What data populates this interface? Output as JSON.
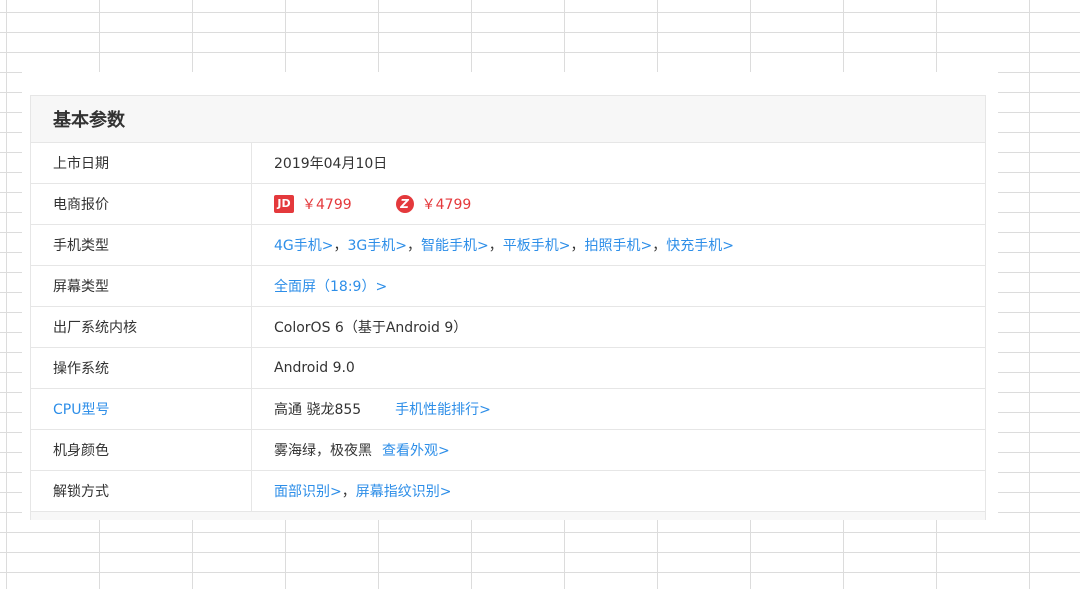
{
  "section": {
    "title": "基本参数"
  },
  "rows": {
    "release_date": {
      "label": "上市日期",
      "value": "2019年04月10日"
    },
    "price": {
      "label": "电商报价",
      "jd_badge": "JD",
      "jd_price": "￥4799",
      "z_badge": "Z",
      "z_price": "￥4799"
    },
    "phone_type": {
      "label": "手机类型",
      "links": [
        "4G手机>",
        "3G手机>",
        "智能手机>",
        "平板手机>",
        "拍照手机>",
        "快充手机>"
      ],
      "sep": "，"
    },
    "screen_type": {
      "label": "屏幕类型",
      "link": "全面屏（18:9）>"
    },
    "kernel": {
      "label": "出厂系统内核",
      "value": "ColorOS 6（基于Android 9）"
    },
    "os": {
      "label": "操作系统",
      "value": "Android 9.0"
    },
    "cpu": {
      "label": "CPU型号",
      "value": "高通 骁龙855",
      "link": "手机性能排行>"
    },
    "color": {
      "label": "机身颜色",
      "value": "雾海绿，极夜黑",
      "link": "查看外观>"
    },
    "unlock": {
      "label": "解锁方式",
      "links": [
        "面部识别>",
        "屏幕指纹识别>"
      ],
      "sep": "，"
    }
  },
  "colors": {
    "link": "#2d8ee8",
    "price": "#e4393c",
    "border": "#e6e6e6",
    "header_bg": "#f7f7f7"
  }
}
